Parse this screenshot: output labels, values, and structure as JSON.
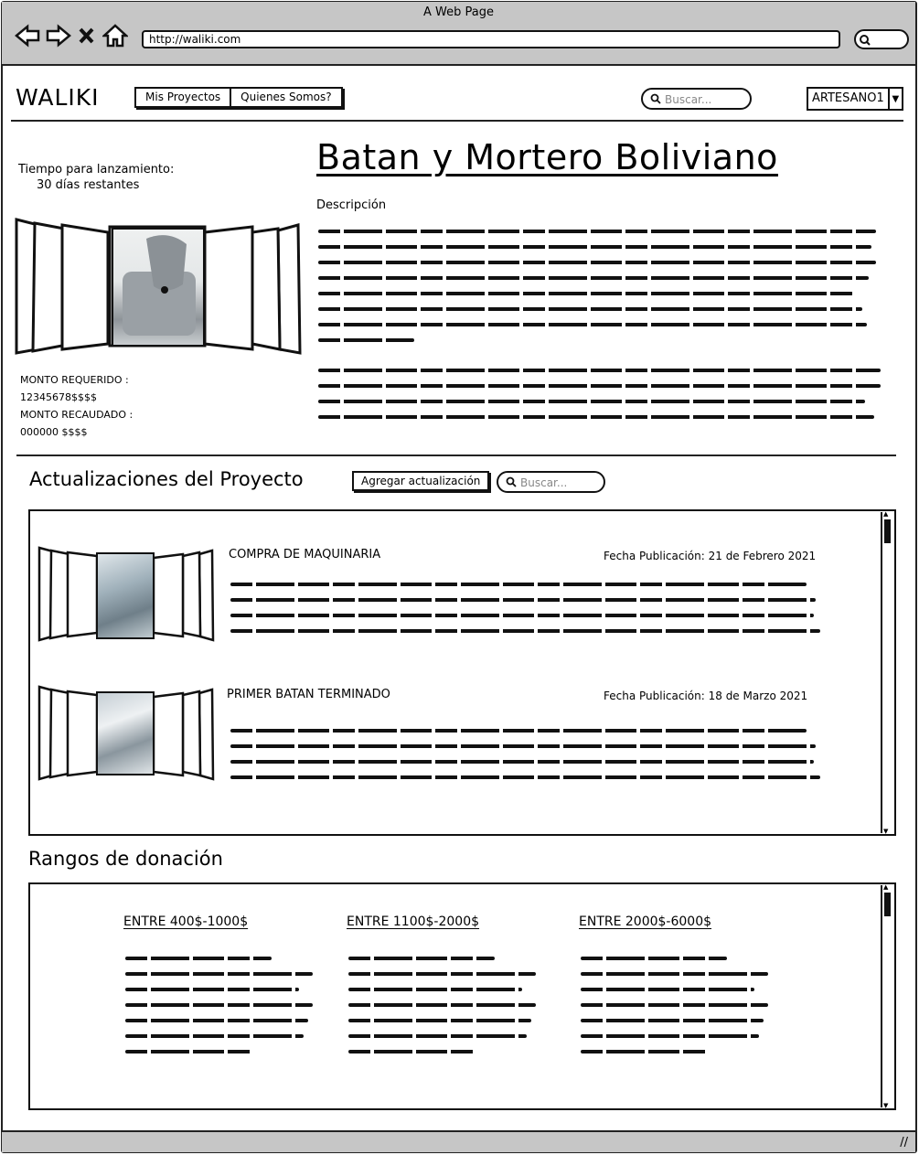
{
  "browser": {
    "window_title": "A Web Page",
    "url": "http://waliki.com"
  },
  "header": {
    "logo": "WALIKI",
    "tabs": [
      "Mis Proyectos",
      "Quienes Somos?"
    ],
    "search_placeholder": "Buscar...",
    "user": "ARTESANO1"
  },
  "project": {
    "title": "Batan y Mortero Boliviano",
    "countdown_label": "Tiempo para lanzamiento:",
    "countdown_value": "30 días restantes",
    "description_label": "Descripción",
    "monto_requerido_label": "MONTO REQUERIDO :",
    "monto_requerido_value": "12345678$$$$",
    "monto_recaudado_label": "MONTO RECAUDADO :",
    "monto_recaudado_value": "000000 $$$$"
  },
  "updates": {
    "title": "Actualizaciones del Proyecto",
    "add_button": "Agregar actualización",
    "search_placeholder": "Buscar...",
    "items": [
      {
        "title": "COMPRA DE MAQUINARIA",
        "date": "Fecha Publicación: 21 de Febrero 2021"
      },
      {
        "title": "PRIMER BATAN TERMINADO",
        "date": "Fecha Publicación: 18 de Marzo 2021"
      }
    ]
  },
  "donations": {
    "title": "Rangos de donación",
    "tiers": [
      {
        "label": "ENTRE 400$-1000$"
      },
      {
        "label": "ENTRE 1100$-2000$"
      },
      {
        "label": "ENTRE 2000$-6000$"
      }
    ]
  },
  "icons": [
    "back-icon",
    "forward-icon",
    "close-icon",
    "home-icon",
    "search-icon",
    "chevron-down-icon",
    "resize-icon"
  ]
}
